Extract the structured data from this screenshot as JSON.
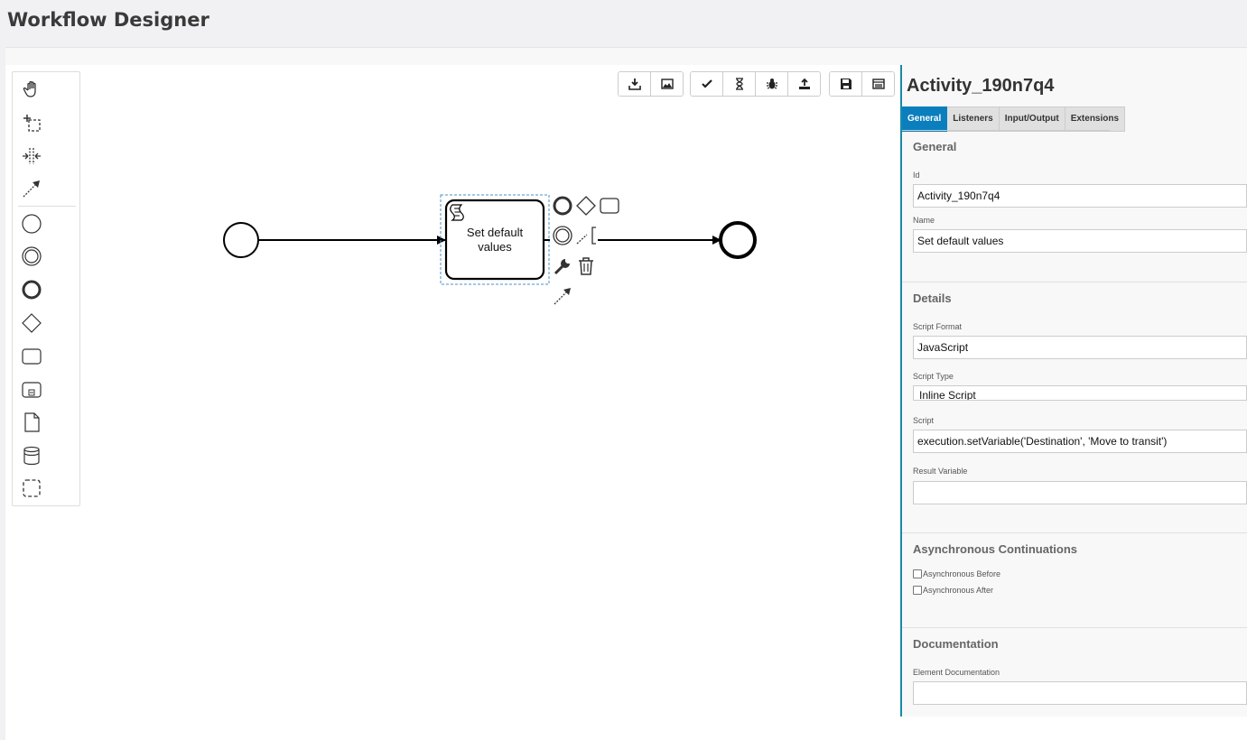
{
  "header": {
    "title": "Workflow Designer"
  },
  "palette": {
    "tools": [
      {
        "name": "hand-tool",
        "icon": "hand-icon"
      },
      {
        "name": "lasso-tool",
        "icon": "lasso-icon"
      },
      {
        "name": "space-tool",
        "icon": "space-icon"
      },
      {
        "name": "global-connect-tool",
        "icon": "connect-icon"
      },
      {
        "name": "start-event-tool",
        "icon": "start-event-icon"
      },
      {
        "name": "intermediate-event-tool",
        "icon": "intermediate-event-icon"
      },
      {
        "name": "end-event-tool",
        "icon": "end-event-icon"
      },
      {
        "name": "gateway-tool",
        "icon": "gateway-icon"
      },
      {
        "name": "task-tool",
        "icon": "task-icon"
      },
      {
        "name": "subprocess-tool",
        "icon": "subprocess-icon"
      },
      {
        "name": "data-object-tool",
        "icon": "data-object-icon"
      },
      {
        "name": "data-store-tool",
        "icon": "data-store-icon"
      },
      {
        "name": "group-tool",
        "icon": "group-icon"
      }
    ]
  },
  "toolbar": {
    "buttons": [
      "download-icon",
      "image-icon",
      "check-icon",
      "hourglass-icon",
      "bug-icon",
      "upload-icon",
      "save-icon",
      "list-icon"
    ]
  },
  "canvas": {
    "task": {
      "label_line1": "Set default",
      "label_line2": "values"
    }
  },
  "panel": {
    "title": "Activity_190n7q4",
    "tabs": [
      "General",
      "Listeners",
      "Input/Output",
      "Extensions"
    ],
    "active_tab": "General",
    "general": {
      "heading": "General",
      "id_label": "Id",
      "id_value": "Activity_190n7q4",
      "name_label": "Name",
      "name_value": "Set default values"
    },
    "details": {
      "heading": "Details",
      "script_format_label": "Script Format",
      "script_format_value": "JavaScript",
      "script_type_label": "Script Type",
      "script_type_value": "Inline Script",
      "script_label": "Script",
      "script_value": "execution.setVariable('Destination', 'Move to transit')",
      "result_variable_label": "Result Variable",
      "result_variable_value": ""
    },
    "async": {
      "heading": "Asynchronous Continuations",
      "before_label": "Asynchronous Before",
      "after_label": "Asynchronous After"
    },
    "documentation": {
      "heading": "Documentation",
      "element_doc_label": "Element Documentation",
      "element_doc_value": ""
    }
  },
  "colors": {
    "accent": "#0b7fbd",
    "panel_border": "#1a8aa6",
    "selection": "#4a90c8"
  }
}
